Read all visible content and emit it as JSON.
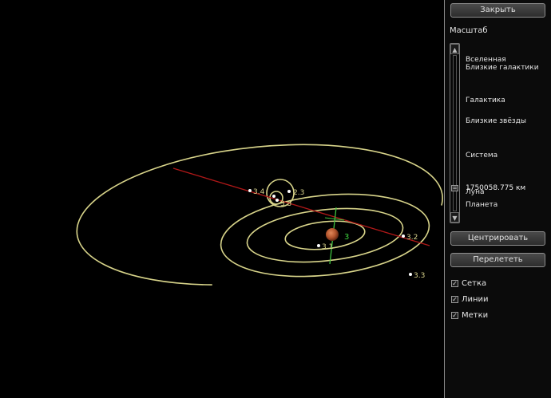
{
  "panel": {
    "close_label": "Закрыть",
    "scale_title": "Масштаб",
    "scale_levels": [
      "Вселенная",
      "Близкие галактики",
      "Галактика",
      "Близкие звёзды",
      "Система",
      "Луна",
      "Планета"
    ],
    "scale_value": "1750058.775 км",
    "center_label": "Центрировать",
    "fly_label": "Перелететь",
    "toggles": [
      {
        "label": "Сетка",
        "checked": true
      },
      {
        "label": "Линии",
        "checked": true
      },
      {
        "label": "Метки",
        "checked": true
      }
    ]
  },
  "scene": {
    "planet_label": "3",
    "body_labels": [
      "3.1",
      "3.2",
      "3.3",
      "3.4",
      "2.3",
      "3.5"
    ],
    "colors": {
      "orbit": "#d8d48a",
      "axis_red": "#b01818",
      "axis_green": "#3ec03e",
      "planet": "#b5562e",
      "planet_label": "#3ed23e"
    }
  }
}
